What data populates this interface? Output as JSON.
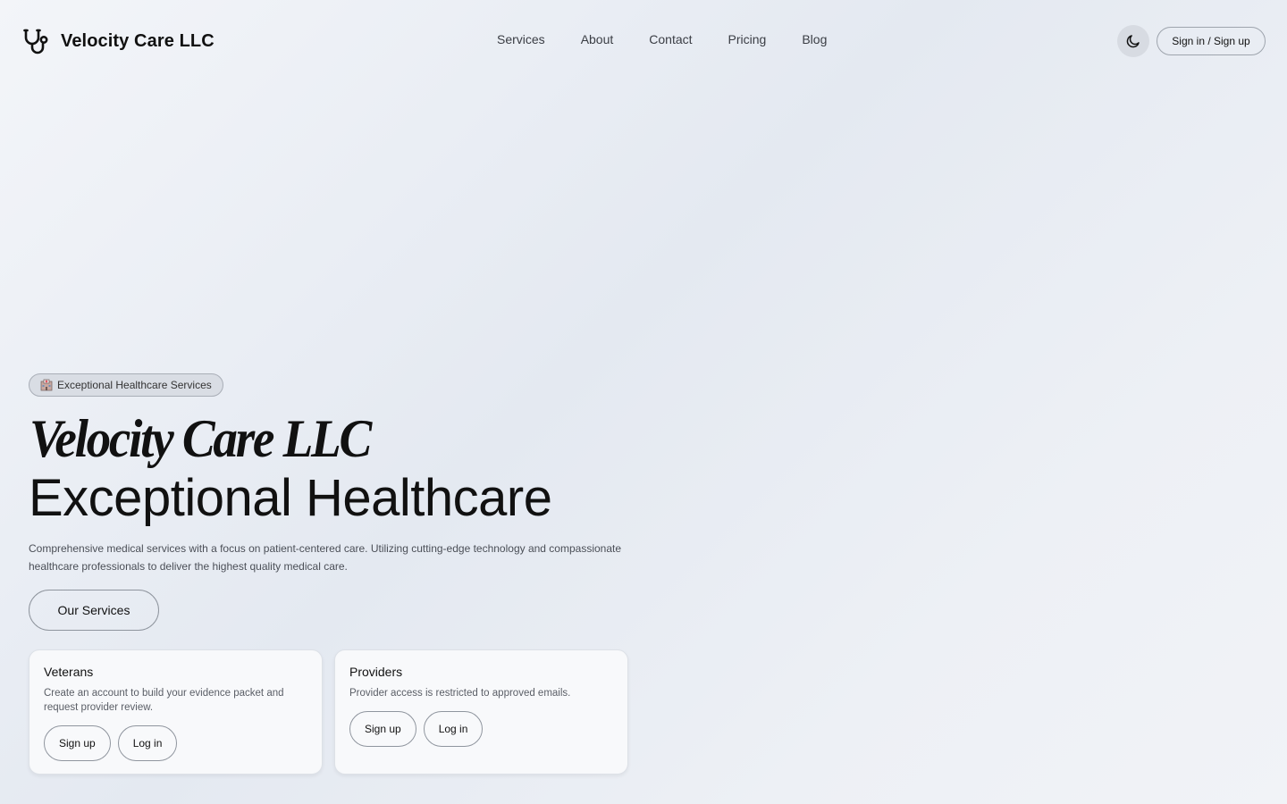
{
  "header": {
    "brand_name": "Velocity Care LLC",
    "brand_icon": "stethoscope-icon",
    "nav": [
      {
        "label": "Services"
      },
      {
        "label": "About"
      },
      {
        "label": "Contact"
      },
      {
        "label": "Pricing"
      },
      {
        "label": "Blog"
      }
    ],
    "theme_toggle_icon": "moon-icon",
    "signin_label": "Sign in / Sign up"
  },
  "hero": {
    "badge_icon": "hospital-icon",
    "badge_label": "Exceptional Healthcare Services",
    "title_line1": "Velocity Care LLC",
    "title_line2": "Exceptional Healthcare",
    "description": "Comprehensive medical services with a focus on patient-centered care. Utilizing cutting-edge technology and compassionate healthcare professionals to deliver the highest quality medical care.",
    "primary_button": "Our Services"
  },
  "cards": [
    {
      "title": "Veterans",
      "description": "Create an account to build your evidence packet and request provider review.",
      "signup_label": "Sign up",
      "login_label": "Log in"
    },
    {
      "title": "Providers",
      "description": "Provider access is restricted to approved emails.",
      "signup_label": "Sign up",
      "login_label": "Log in"
    }
  ],
  "colors": {
    "text": "#111111",
    "muted_text": "#4b4f57",
    "border": "#8f959e",
    "badge_bg": "#d9dde4",
    "toggle_bg": "#d7dbe2",
    "card_bg": "#f8f9fb"
  }
}
